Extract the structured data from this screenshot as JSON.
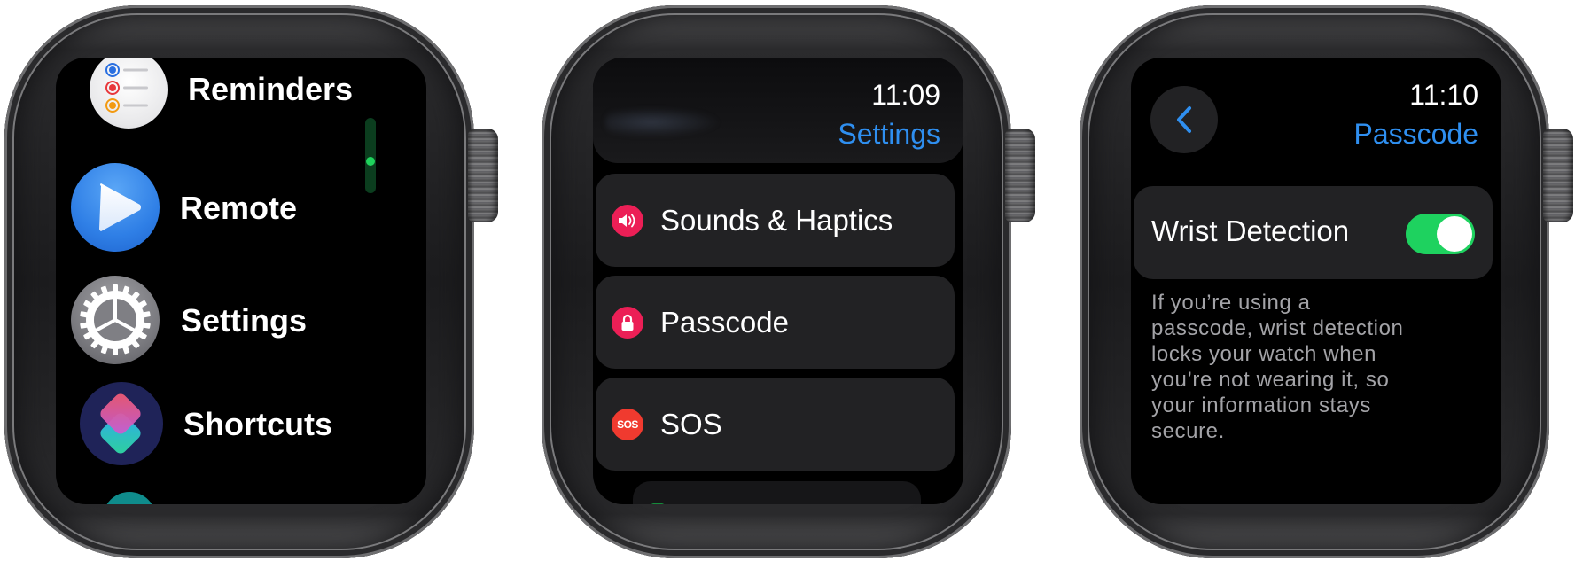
{
  "watches": [
    {
      "screen": "app-list",
      "apps": [
        {
          "label": "Reminders",
          "icon": "reminders-icon"
        },
        {
          "label": "Remote",
          "icon": "remote-play-icon"
        },
        {
          "label": "Settings",
          "icon": "settings-gear-icon"
        },
        {
          "label": "Shortcuts",
          "icon": "shortcuts-icon"
        }
      ],
      "scroll_position": 0.6
    },
    {
      "screen": "settings",
      "time": "11:09",
      "title": "Settings",
      "items": [
        {
          "label": "Sounds & Haptics",
          "icon": "speaker-icon",
          "color": "#ec1f56"
        },
        {
          "label": "Passcode",
          "icon": "lock-icon",
          "color": "#ec1f56"
        },
        {
          "label": "SOS",
          "icon": "sos-icon",
          "icon_text": "SOS",
          "color": "#f03a2f"
        }
      ]
    },
    {
      "screen": "passcode",
      "time": "11:10",
      "title": "Passcode",
      "back_icon": "chevron-left-icon",
      "toggle": {
        "label": "Wrist Detection",
        "on": true,
        "color": "#1ed25f"
      },
      "description": "If you’re using a\npasscode, wrist detection\nlocks your watch when\nyou’re not wearing it, so\nyour information stays\nsecure."
    }
  ],
  "colors": {
    "accent": "#2f8ff0",
    "toggle_on": "#1ed25f",
    "card_bg": "#222224"
  }
}
